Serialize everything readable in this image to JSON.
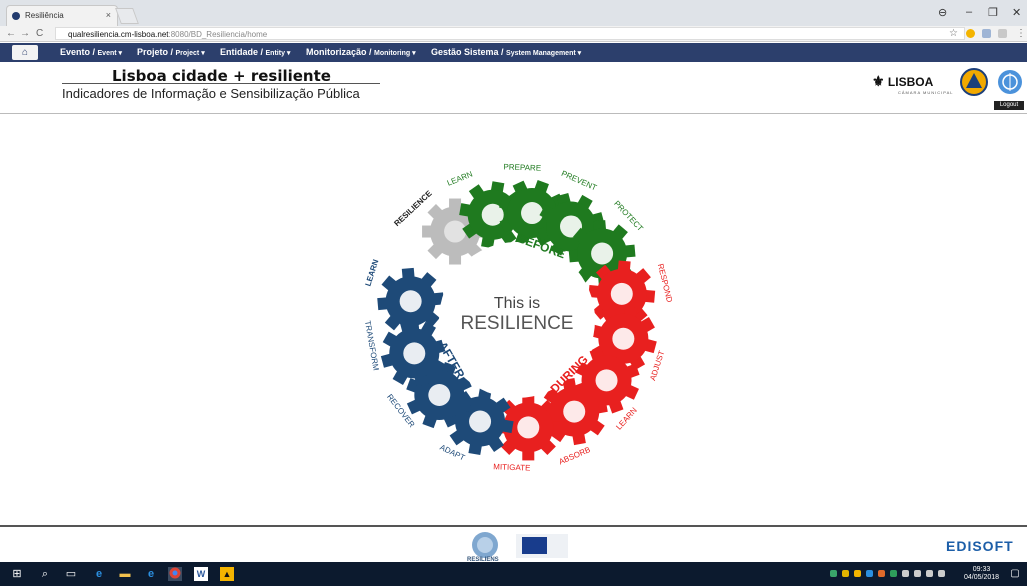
{
  "browser": {
    "tab_title": "Resiliência",
    "tab_close": "×",
    "url_host": "qualresiliencia.cm-lisboa.net",
    "url_path": ":8080/BD_Resiliencia/home",
    "back_icon": "←",
    "forward_icon": "→",
    "reload_icon": "C",
    "star_icon": "☆",
    "minimize": "–",
    "restore": "❐",
    "close": "✕",
    "more": "⋮",
    "profile_icon": "⊖"
  },
  "nav": {
    "home_icon": "⌂",
    "items": [
      {
        "label": "Evento / ",
        "sub": "Event"
      },
      {
        "label": "Projeto / ",
        "sub": "Project"
      },
      {
        "label": "Entidade / ",
        "sub": "Entity"
      },
      {
        "label": "Monitorização / ",
        "sub": "Monitoring"
      },
      {
        "label": "Gestão Sistema / ",
        "sub": "System Management"
      }
    ]
  },
  "header": {
    "title": "Lisboa cidade + resiliente",
    "subtitle": "Indicadores de Informação e Sensibilização Pública",
    "lisboa_logo": "LISBOA",
    "lisboa_logo_sub": "CÂMARA MUNICIPAL",
    "logout": "Logout"
  },
  "diagram": {
    "center_line1": "This is",
    "center_line2": "RESILIENCE",
    "phase_before": "BEFORE",
    "phase_during": "DURING",
    "phase_after": "AFTER",
    "labels": {
      "resilience": "RESILIENCE",
      "learn_top": "LEARN",
      "prepare": "PREPARE",
      "prevent": "PREVENT",
      "protect": "PROTECT",
      "respond": "RESPOND",
      "adjust": "ADJUST",
      "learn_right": "LEARN",
      "absorb": "ABSORB",
      "mitigate": "MITIGATE",
      "adapt": "ADAPT",
      "recover": "RECOVER",
      "transform": "TRANSFORM",
      "learn_left": "LEARN"
    },
    "colors": {
      "green": "#1f7a1f",
      "red": "#e8201f",
      "blue": "#1e4a78",
      "grey": "#bcbcbc"
    }
  },
  "footer": {
    "resiliens": "RESILIENS",
    "edisoft": "EDISOFT"
  },
  "taskbar": {
    "time": "09:33",
    "date": "04/05/2018"
  }
}
